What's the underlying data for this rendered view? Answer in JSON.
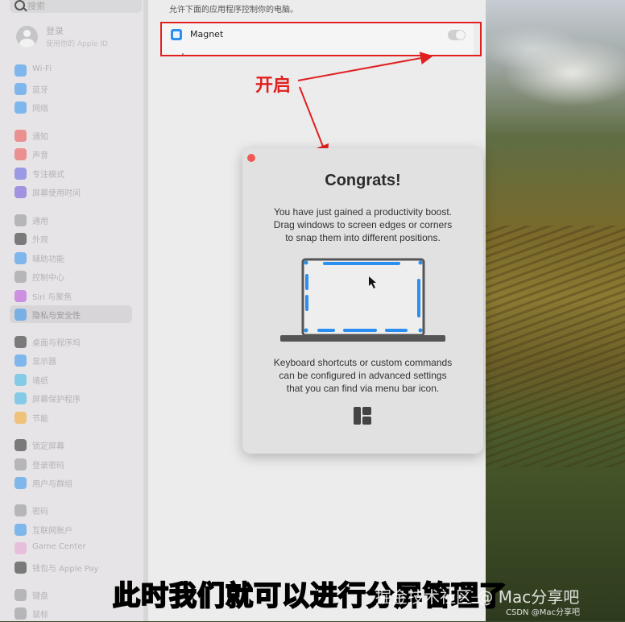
{
  "sidebar": {
    "search_placeholder": "搜索",
    "login": {
      "title": "登录",
      "subtitle": "使用你的 Apple ID"
    },
    "items": [
      {
        "label": "Wi-Fi",
        "icon": "wifi-icon",
        "color": "#2a8ff0"
      },
      {
        "label": "蓝牙",
        "icon": "bluetooth-icon",
        "color": "#2a8ff0"
      },
      {
        "label": "网络",
        "icon": "network-icon",
        "color": "#2a8ff0"
      },
      {
        "label": "通知",
        "icon": "notification-icon",
        "color": "#ef4b4b"
      },
      {
        "label": "声音",
        "icon": "sound-icon",
        "color": "#ef4b4b"
      },
      {
        "label": "专注模式",
        "icon": "focus-icon",
        "color": "#5b5be0"
      },
      {
        "label": "屏幕使用时间",
        "icon": "screen-time-icon",
        "color": "#6b4fd8"
      },
      {
        "label": "通用",
        "icon": "general-icon",
        "color": "#8e8e93"
      },
      {
        "label": "外观",
        "icon": "appearance-icon",
        "color": "#222222"
      },
      {
        "label": "辅助功能",
        "icon": "accessibility-icon",
        "color": "#2a8ff0"
      },
      {
        "label": "控制中心",
        "icon": "control-center-icon",
        "color": "#8e8e93"
      },
      {
        "label": "Siri 与聚焦",
        "icon": "siri-icon",
        "color": "#b44bd8"
      },
      {
        "label": "隐私与安全性",
        "icon": "privacy-icon",
        "color": "#2a8ff0"
      },
      {
        "label": "桌面与程序坞",
        "icon": "desktop-dock-icon",
        "color": "#222222"
      },
      {
        "label": "显示器",
        "icon": "display-icon",
        "color": "#2a8ff0"
      },
      {
        "label": "墙纸",
        "icon": "wallpaper-icon",
        "color": "#35b5e8"
      },
      {
        "label": "屏幕保护程序",
        "icon": "screensaver-icon",
        "color": "#35b5e8"
      },
      {
        "label": "节能",
        "icon": "energy-icon",
        "color": "#f5a623"
      },
      {
        "label": "锁定屏幕",
        "icon": "lock-screen-icon",
        "color": "#222222"
      },
      {
        "label": "登录密码",
        "icon": "login-password-icon",
        "color": "#8e8e93"
      },
      {
        "label": "用户与群组",
        "icon": "users-icon",
        "color": "#2a8ff0"
      },
      {
        "label": "密码",
        "icon": "passwords-icon",
        "color": "#8e8e93"
      },
      {
        "label": "互联网账户",
        "icon": "internet-accounts-icon",
        "color": "#2a8ff0"
      },
      {
        "label": "Game Center",
        "icon": "game-center-icon",
        "color": "#e8a0d0"
      },
      {
        "label": "钱包与 Apple Pay",
        "icon": "wallet-icon",
        "color": "#222222"
      },
      {
        "label": "键盘",
        "icon": "keyboard-icon",
        "color": "#8e8e93"
      },
      {
        "label": "鼠标",
        "icon": "mouse-icon",
        "color": "#8e8e93"
      }
    ]
  },
  "content": {
    "description": "允许下面的应用程序控制你的电脑。",
    "app": {
      "name": "Magnet",
      "enabled": true
    }
  },
  "annotation": {
    "label": "开启",
    "color": "#e02020"
  },
  "dialog": {
    "title": "Congrats!",
    "line1": "You have just gained a productivity boost.",
    "line2": "Drag windows to screen edges or corners",
    "line3": "to snap them into different positions.",
    "line4": "Keyboard shortcuts or custom commands",
    "line5": "can be configured in advanced settings",
    "line6": "that you can find via menu bar icon."
  },
  "caption": {
    "part1": "此时我们就可以进行",
    "part2": "分屏管理",
    "part3": "了"
  },
  "watermark": {
    "text1": "掘金技术社区 @ Mac分享吧",
    "text2": "CSDN @Mac分享吧"
  },
  "colors": {
    "accent": "#2a8ff0",
    "highlight": "#f5e23b"
  }
}
